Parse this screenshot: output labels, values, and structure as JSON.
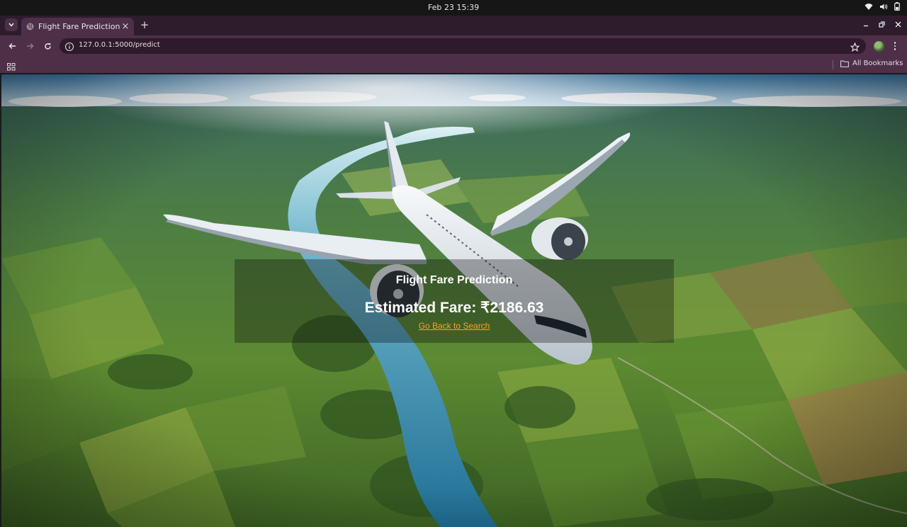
{
  "os": {
    "clock": "Feb 23  15:39"
  },
  "browser": {
    "tab": {
      "title": "Flight Fare Prediction"
    },
    "address": {
      "url": "127.0.0.1:5000/predict"
    },
    "bookmarks": {
      "all_label": "All Bookmarks"
    }
  },
  "page": {
    "title": "Flight Fare Prediction",
    "fare_text": "Estimated Fare: ₹2186.63",
    "back_link": "Go Back to Search"
  },
  "icons": [
    "tab-search-icon",
    "globe-icon",
    "close-icon",
    "plus-icon",
    "minimize-icon",
    "restore-icon",
    "back-arrow-icon",
    "forward-arrow-icon",
    "reload-icon",
    "info-icon",
    "star-icon",
    "apps-grid-icon",
    "folder-icon",
    "wifi-icon",
    "volume-icon",
    "battery-icon"
  ],
  "colors": {
    "tab_bar": "#2e1c2c",
    "toolbar": "#4d2f48",
    "link": "#ff9e2c"
  }
}
